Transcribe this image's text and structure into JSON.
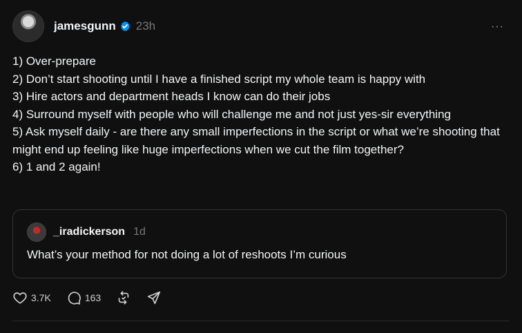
{
  "post": {
    "username": "jamesgunn",
    "time": "23h",
    "more_label": "···",
    "lines": [
      "1) Over-prepare",
      "2) Don’t start shooting until I have a finished script my whole team is happy with",
      "3) Hire actors and department heads I know can do their jobs",
      "4) Surround myself with people who will challenge me and not just yes-sir everything",
      "5) Ask myself daily - are there any small imperfections in the script or what we’re shooting that might end up feeling like huge imperfections when we cut the film together?",
      "6) 1 and 2 again!"
    ]
  },
  "quote": {
    "username": "_iradickerson",
    "time": "1d",
    "text": "What’s your method for not doing a lot of reshoots I’m curious"
  },
  "actions": {
    "likes": "3.7K",
    "replies": "163"
  },
  "colors": {
    "background": "#101010",
    "text": "#f3f5f7",
    "muted": "#777777",
    "verified": "#0095f6",
    "border": "#343434"
  },
  "icons": [
    "verified-icon",
    "more-icon",
    "heart-icon",
    "comment-icon",
    "repost-icon",
    "share-icon"
  ]
}
